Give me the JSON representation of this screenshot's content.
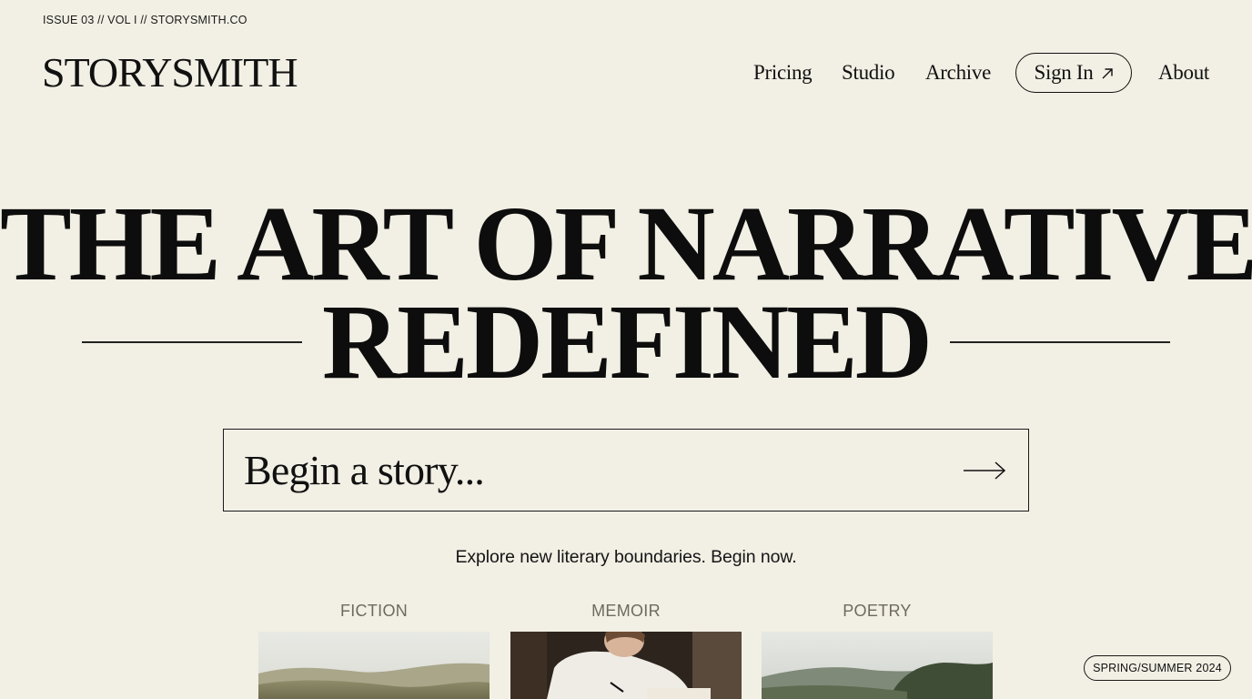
{
  "header": {
    "issue_line": "ISSUE 03 // VOL I // STORYSMITH.CO",
    "logo": "STORYSMITH"
  },
  "nav": {
    "items": [
      {
        "label": "Pricing"
      },
      {
        "label": "Studio"
      },
      {
        "label": "Archive"
      },
      {
        "label": "Sign In",
        "icon": "arrow-up-right-icon"
      },
      {
        "label": "About"
      }
    ]
  },
  "hero": {
    "line1": "THE ART OF NARRATIVE",
    "line2": "REDEFINED"
  },
  "story_input": {
    "placeholder": "Begin a story...",
    "value": "",
    "submit_icon": "arrow-right-icon"
  },
  "tagline": "Explore new literary boundaries. Begin now.",
  "categories": [
    {
      "label": "FICTION",
      "image": "landscape-hills-photo"
    },
    {
      "label": "MEMOIR",
      "image": "person-writing-photo"
    },
    {
      "label": "POETRY",
      "image": "forest-hills-photo"
    }
  ],
  "badge": "SPRING/SUMMER 2024",
  "colors": {
    "background": "#f2efe4",
    "ink": "#111111",
    "muted": "#6d6a62"
  }
}
